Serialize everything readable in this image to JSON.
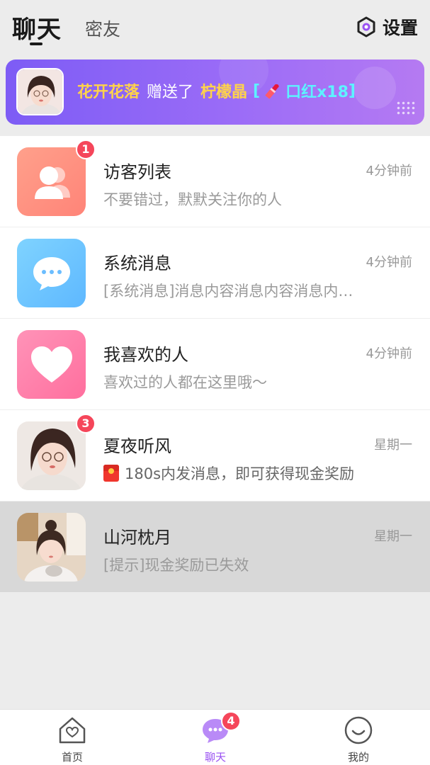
{
  "header": {
    "tabs": [
      {
        "label": "聊天",
        "active": true
      },
      {
        "label": "密友",
        "active": false
      }
    ],
    "settings_label": "设置",
    "settings_icon": "hexagon-gear-icon"
  },
  "gift_banner": {
    "sender": "花开花落",
    "action": "赠送了",
    "receiver": "柠檬晶",
    "gift_open": "[",
    "gift_icon": "lipstick-icon",
    "gift_text": "口红x18",
    "gift_close": "]"
  },
  "conversations": [
    {
      "title": "访客列表",
      "time": "4分钟前",
      "preview": "不要错过，默默关注你的人",
      "badge": "1",
      "icon": "visitors-icon",
      "color": "#ff8f83"
    },
    {
      "title": "系统消息",
      "time": "4分钟前",
      "preview": "[系统消息]消息内容消息内容消息内…",
      "badge": "",
      "icon": "chat-bubble-icon",
      "color": "#69c6ff"
    },
    {
      "title": "我喜欢的人",
      "time": "4分钟前",
      "preview": "喜欢过的人都在这里哦～",
      "badge": "",
      "icon": "heart-icon",
      "color": "#ff7fa9"
    },
    {
      "title": "夏夜听风",
      "time": "星期一",
      "preview": "180s内发消息，即可获得现金奖励",
      "badge": "3",
      "icon": "red-packet-icon",
      "color": "#f0362d"
    },
    {
      "title": "山河枕月",
      "time": "星期一",
      "preview": "[提示]现金奖励已失效",
      "badge": "",
      "icon": "",
      "color": ""
    }
  ],
  "bottom_nav": [
    {
      "label": "首页",
      "icon": "home-icon",
      "active": false
    },
    {
      "label": "聊天",
      "icon": "chat-icon",
      "active": true,
      "badge": "4"
    },
    {
      "label": "我的",
      "icon": "profile-icon",
      "active": false
    }
  ],
  "colors": {
    "accent": "#9a52f2",
    "badge": "#f5465a",
    "banner_start": "#7d5cf5",
    "banner_end": "#b57af2"
  }
}
